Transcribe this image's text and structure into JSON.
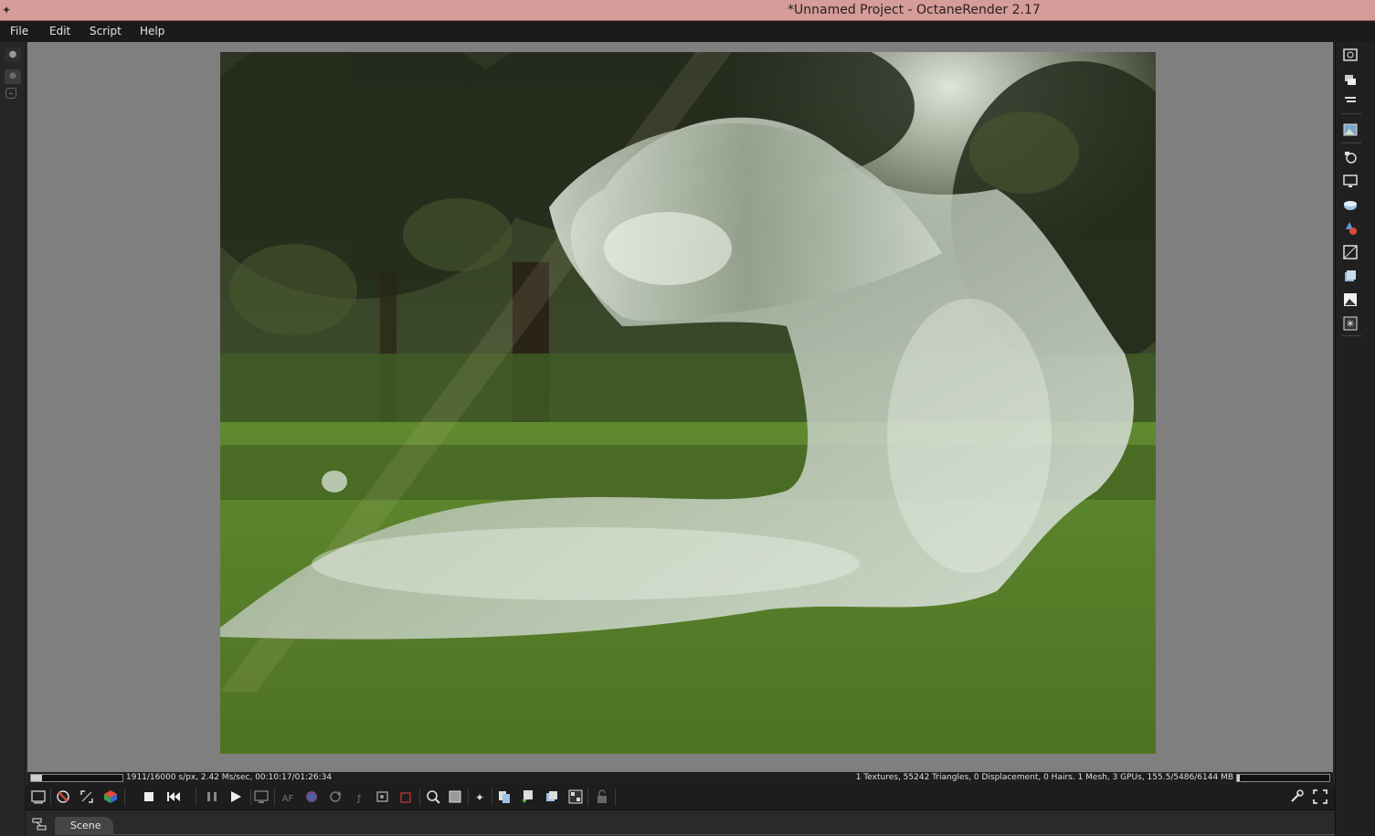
{
  "window": {
    "title": "*Unnamed Project - OctaneRender 2.17",
    "icon": "octane-app-icon"
  },
  "menu": {
    "items": [
      {
        "label": "File"
      },
      {
        "label": "Edit"
      },
      {
        "label": "Script"
      },
      {
        "label": "Help"
      }
    ]
  },
  "left_strip": {
    "buttons": [
      "pin-icon",
      "zoom-icon",
      "collapse-icon"
    ]
  },
  "right_panel": {
    "buttons": [
      "render-viewport-icon",
      "layers-icon",
      "outliner-icon",
      "image-icon",
      "camera-settings-icon",
      "film-settings-icon",
      "environment-icon",
      "material-icon",
      "texture-icon",
      "geometry-icon",
      "imager-icon",
      "postprocess-icon"
    ]
  },
  "render": {
    "description_icon": "render-output"
  },
  "status": {
    "left_text": "1911/16000 s/px, 2.42 Ms/sec, 00:10:17/01:26:34",
    "left_progress": 0.12,
    "right_text": "1 Textures, 55242 Triangles, 0 Displacement, 0 Hairs. 1 Mesh, 3 GPUs, 155.5/5486/6144 MB",
    "right_progress": 0.03
  },
  "toolbar": {
    "buttons": [
      "viewport-screenshot-icon",
      "clear-render-icon",
      "fit-view-icon",
      "scene-cube-icon",
      "stop-icon",
      "restart-icon",
      "pause-icon",
      "start-icon",
      "realtime-icon",
      "af-icon",
      "color-picker-icon",
      "refresh-icon",
      "focus-picker-icon",
      "white-balance-icon",
      "material-picker-icon",
      "camera-target-icon",
      "region-render-icon",
      "film-region-icon",
      "copy-icon",
      "paste-icon",
      "clay-mode-icon",
      "subsample-icon",
      "lock-viewport-icon",
      "settings-wrench-icon",
      "fullscreen-icon"
    ]
  },
  "tabs": {
    "scene_label": "Scene",
    "icon": "graph-editor-icon"
  },
  "colors": {
    "titlebar": "#d59c99",
    "menubar": "#1b1b1b",
    "viewport_bg": "#7f7f7f"
  }
}
